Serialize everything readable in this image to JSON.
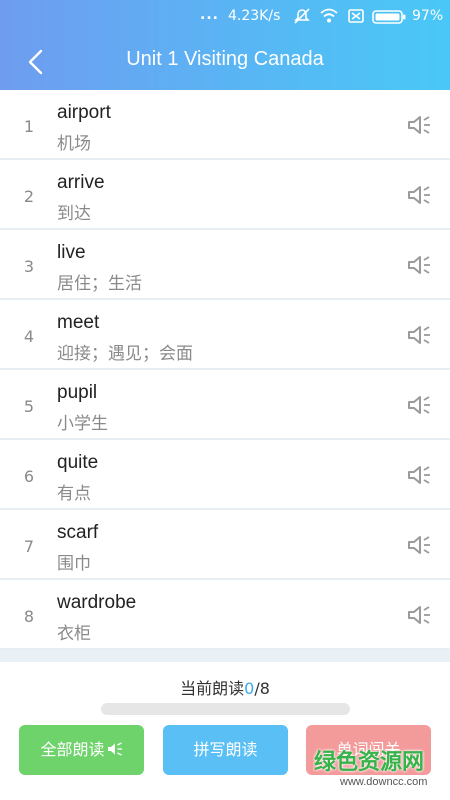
{
  "status_bar": {
    "dots": "...",
    "network_speed": "4.23K/s",
    "icons": [
      "mute-icon",
      "wifi-icon",
      "sim-off-icon",
      "battery-icon"
    ],
    "battery": "97%"
  },
  "header": {
    "back_icon": "chevron-left-icon",
    "title": "Unit 1 Visiting Canada",
    "gradient": [
      "#6f9cf0",
      "#49c8f6"
    ]
  },
  "words": [
    {
      "num": "1",
      "word": "airport",
      "meaning": "机场"
    },
    {
      "num": "2",
      "word": "arrive",
      "meaning": "到达"
    },
    {
      "num": "3",
      "word": "live",
      "meaning": "居住；生活"
    },
    {
      "num": "4",
      "word": "meet",
      "meaning": "迎接；遇见；会面"
    },
    {
      "num": "5",
      "word": "pupil",
      "meaning": "小学生"
    },
    {
      "num": "6",
      "word": "quite",
      "meaning": "有点"
    },
    {
      "num": "7",
      "word": "scarf",
      "meaning": "围巾"
    },
    {
      "num": "8",
      "word": "wardrobe",
      "meaning": "衣柜"
    }
  ],
  "progress": {
    "label": "当前朗读",
    "current": "0",
    "total": "/8",
    "fraction": 0
  },
  "buttons": {
    "read_all": "全部朗读",
    "spell_read": "拼写朗读",
    "word_level": "单词闯关"
  },
  "colors": {
    "accent": "#3aa7ee",
    "green_button": "#6fd36c",
    "blue_button": "#59bff5",
    "red_button": "#f39a9a"
  },
  "watermark": {
    "main": "绿色资源网",
    "sub": "www.downcc.com"
  }
}
